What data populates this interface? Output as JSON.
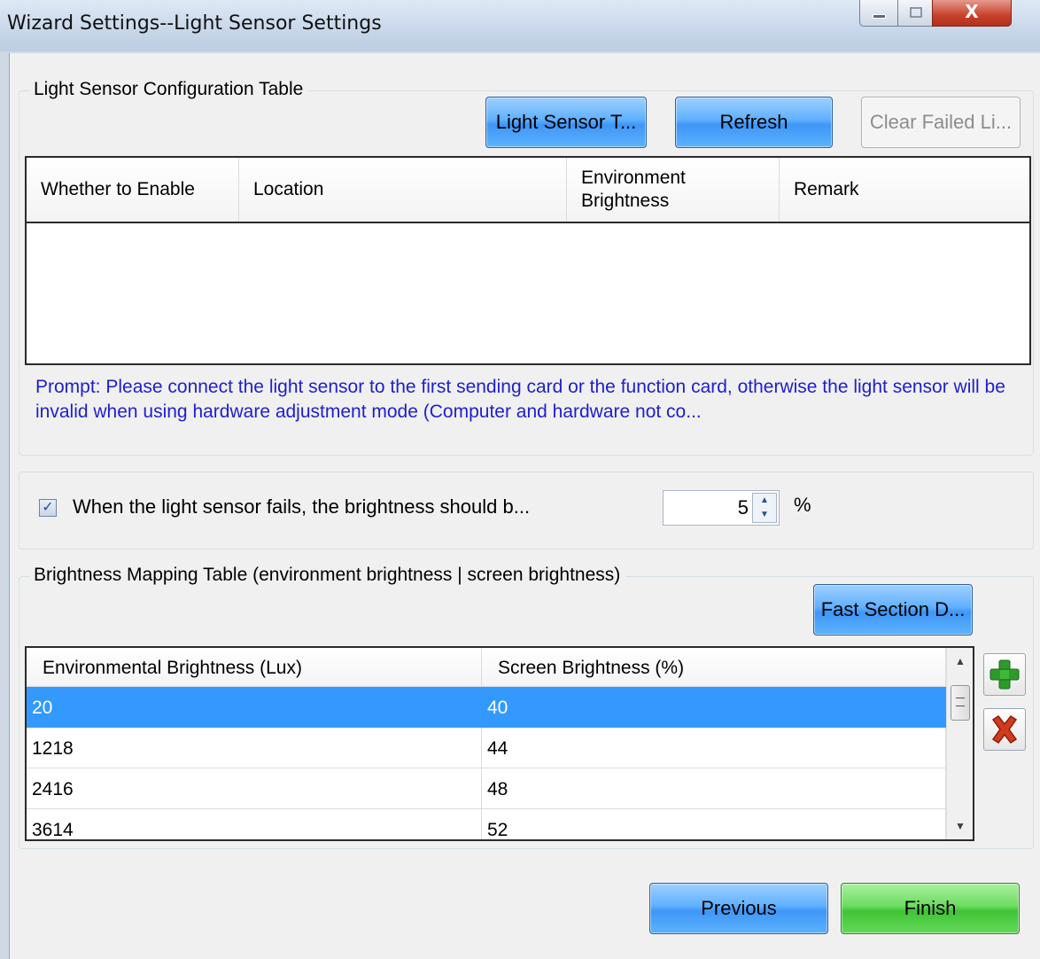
{
  "window": {
    "title": "Wizard Settings--Light Sensor Settings",
    "close_glyph": "X"
  },
  "config_group": {
    "legend": "Light Sensor Configuration Table",
    "buttons": {
      "light_sensor_test": "Light Sensor T...",
      "refresh": "Refresh",
      "clear_failed": "Clear Failed Li..."
    },
    "columns": [
      "Whether to Enable",
      "Location",
      "Environment Brightness",
      "Remark"
    ],
    "rows": [],
    "prompt": "Prompt: Please connect the light sensor to the first sending card or the function card, otherwise the light sensor will be invalid when using hardware adjustment mode (Computer and hardware not co..."
  },
  "fail_group": {
    "checkbox_checked": true,
    "checkbox_label": "When the light sensor fails, the brightness should b...",
    "value": "5",
    "unit": "%"
  },
  "mapping_group": {
    "legend": "Brightness Mapping Table (environment brightness | screen brightness)",
    "fast_section_button": "Fast Section D...",
    "columns": [
      "Environmental Brightness (Lux)",
      "Screen Brightness (%)"
    ],
    "rows": [
      {
        "env": "20",
        "screen": "40",
        "selected": true
      },
      {
        "env": "1218",
        "screen": "44",
        "selected": false
      },
      {
        "env": "2416",
        "screen": "48",
        "selected": false
      },
      {
        "env": "3614",
        "screen": "52",
        "selected": false
      }
    ],
    "add_icon": "plus-icon",
    "delete_icon": "delete-x-icon"
  },
  "footer": {
    "previous": "Previous",
    "finish": "Finish"
  },
  "colors": {
    "prompt_text": "#1e1ed0",
    "selection": "#3399ff",
    "button_blue": "#5fb0ff",
    "button_green": "#40c435"
  }
}
